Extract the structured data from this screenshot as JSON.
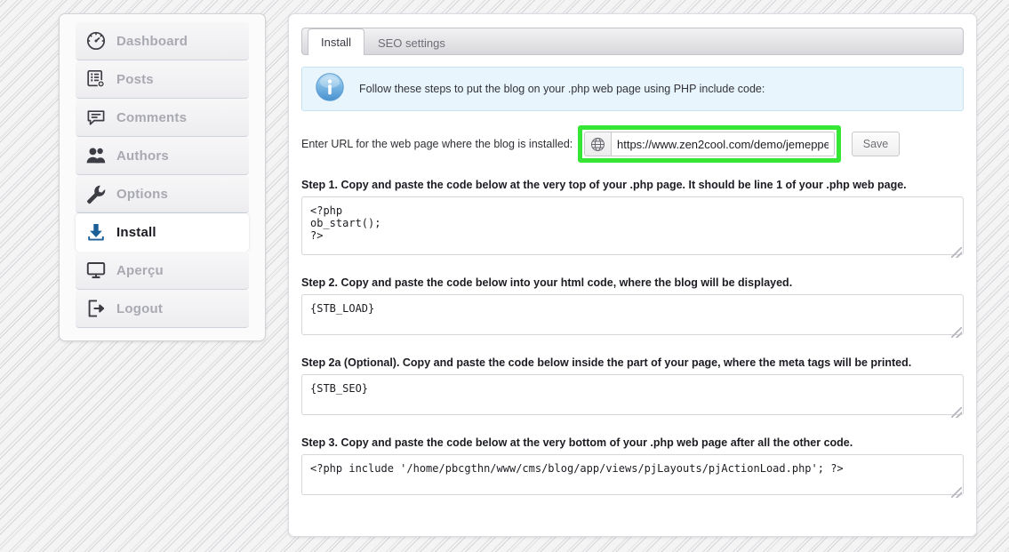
{
  "sidebar": {
    "items": [
      {
        "label": "Dashboard",
        "icon": "gauge-icon",
        "active": false
      },
      {
        "label": "Posts",
        "icon": "posts-icon",
        "active": false
      },
      {
        "label": "Comments",
        "icon": "comment-icon",
        "active": false
      },
      {
        "label": "Authors",
        "icon": "users-icon",
        "active": false
      },
      {
        "label": "Options",
        "icon": "wrench-icon",
        "active": false
      },
      {
        "label": "Install",
        "icon": "download-icon",
        "active": true
      },
      {
        "label": "Aperçu",
        "icon": "monitor-icon",
        "active": false
      },
      {
        "label": "Logout",
        "icon": "logout-icon",
        "active": false
      }
    ]
  },
  "tabs": [
    {
      "label": "Install",
      "active": true
    },
    {
      "label": "SEO settings",
      "active": false
    }
  ],
  "info": {
    "icon": "info-icon",
    "text": "Follow these steps to put the blog on your .php web page using PHP include code:"
  },
  "url_row": {
    "label": "Enter URL for the web page where the blog is installed:",
    "addon_icon": "globe-icon",
    "input_value": "https://www.zen2cool.com/demo/jemeppe",
    "input_placeholder": "",
    "save_label": "Save",
    "highlight_color": "#35e635"
  },
  "steps": [
    {
      "title": "Step 1. Copy and paste the code below at the very top of your .php page. It should be line 1 of your .php web page.",
      "code": "<?php\nob_start();\n?>",
      "rows": 4
    },
    {
      "title": "Step 2. Copy and paste the code below into your html code, where the blog will be displayed.",
      "code": "{STB_LOAD}",
      "rows": 2
    },
    {
      "title": "Step 2a (Optional). Copy and paste the code below inside the part of your page, where the meta tags will be printed.",
      "code": "{STB_SEO}",
      "rows": 2
    },
    {
      "title": "Step 3. Copy and paste the code below at the very bottom of your .php web page after all the other code.",
      "code": "<?php include '/home/pbcgthn/www/cms/blog/app/views/pjLayouts/pjActionLoad.php'; ?>",
      "rows": 2
    }
  ]
}
